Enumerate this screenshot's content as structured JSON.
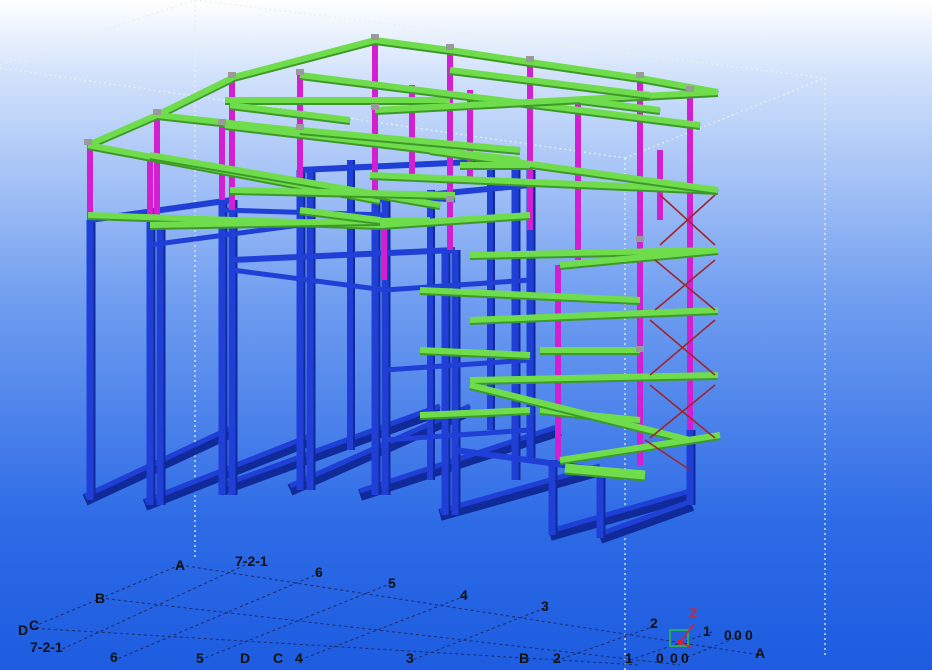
{
  "viewport": {
    "title": "",
    "background_top": "#ffffff",
    "background_bottom": "#1d5ce0"
  },
  "colors": {
    "column": "#1f3fd6",
    "column_dark": "#102a9a",
    "beam": "#6fdc4c",
    "beam_dark": "#3d9a2a",
    "upper_column": "#d21fd2",
    "brace": "#a0262e",
    "grid_line": "#1a2a6a",
    "bounding_box": "#e6f0e6"
  },
  "grid_labels": {
    "back_row": [
      "A",
      "7-2-1",
      "6",
      "5",
      "4",
      "3",
      "2",
      "1",
      "0",
      "0",
      "0"
    ],
    "left_col": [
      "B",
      "D",
      "C"
    ],
    "front_row": [
      "7-2-1",
      "6",
      "5",
      "D",
      "C",
      "4",
      "3",
      "B",
      "2",
      "1",
      "0",
      "0",
      "0"
    ],
    "right_end": "A"
  },
  "axis_indicator": {
    "z_label": "Z",
    "icon": "axis-triad-icon"
  }
}
